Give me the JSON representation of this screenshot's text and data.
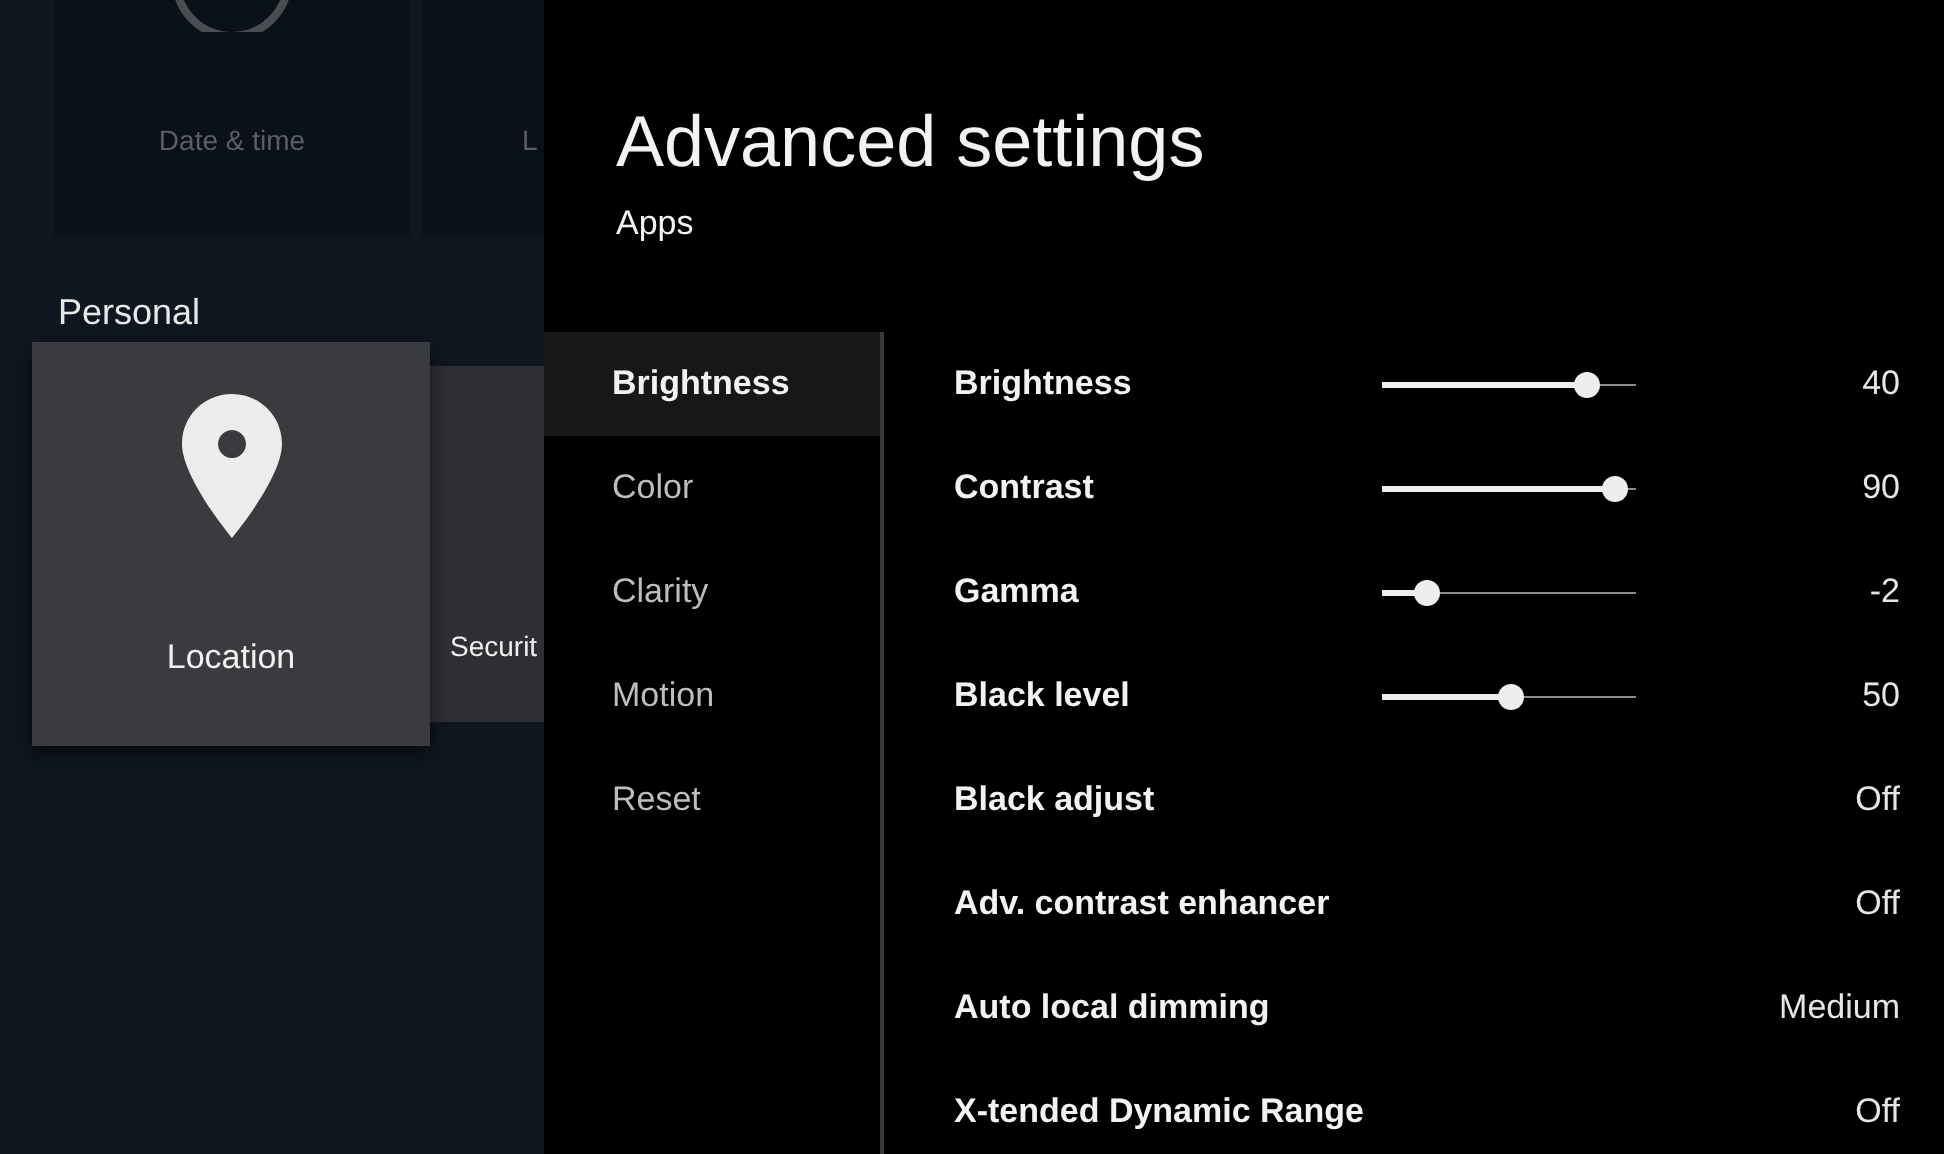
{
  "background": {
    "top_cards": [
      {
        "label": "Date & time"
      },
      {
        "label": "L"
      }
    ],
    "section_title": "Personal",
    "cards": [
      {
        "label": "Location",
        "selected": true
      },
      {
        "label": "Securit",
        "selected": false
      }
    ]
  },
  "panel": {
    "title": "Advanced settings",
    "subtitle": "Apps",
    "categories": [
      {
        "label": "Brightness",
        "selected": true
      },
      {
        "label": "Color",
        "selected": false
      },
      {
        "label": "Clarity",
        "selected": false
      },
      {
        "label": "Motion",
        "selected": false
      },
      {
        "label": "Reset",
        "selected": false
      }
    ],
    "settings": [
      {
        "kind": "slider",
        "label": "Brightness",
        "level": 0.8,
        "value": "40"
      },
      {
        "kind": "slider",
        "label": "Contrast",
        "level": 0.91,
        "value": "90"
      },
      {
        "kind": "slider",
        "label": "Gamma",
        "level": 0.17,
        "value": "-2"
      },
      {
        "kind": "slider",
        "label": "Black level",
        "level": 0.5,
        "value": "50"
      },
      {
        "kind": "option",
        "label": "Black adjust",
        "value": "Off"
      },
      {
        "kind": "option",
        "label": "Adv. contrast enhancer",
        "value": "Off"
      },
      {
        "kind": "option",
        "label": "Auto local dimming",
        "value": "Medium"
      },
      {
        "kind": "option",
        "label": "X-tended Dynamic Range",
        "value": "Off"
      }
    ]
  }
}
